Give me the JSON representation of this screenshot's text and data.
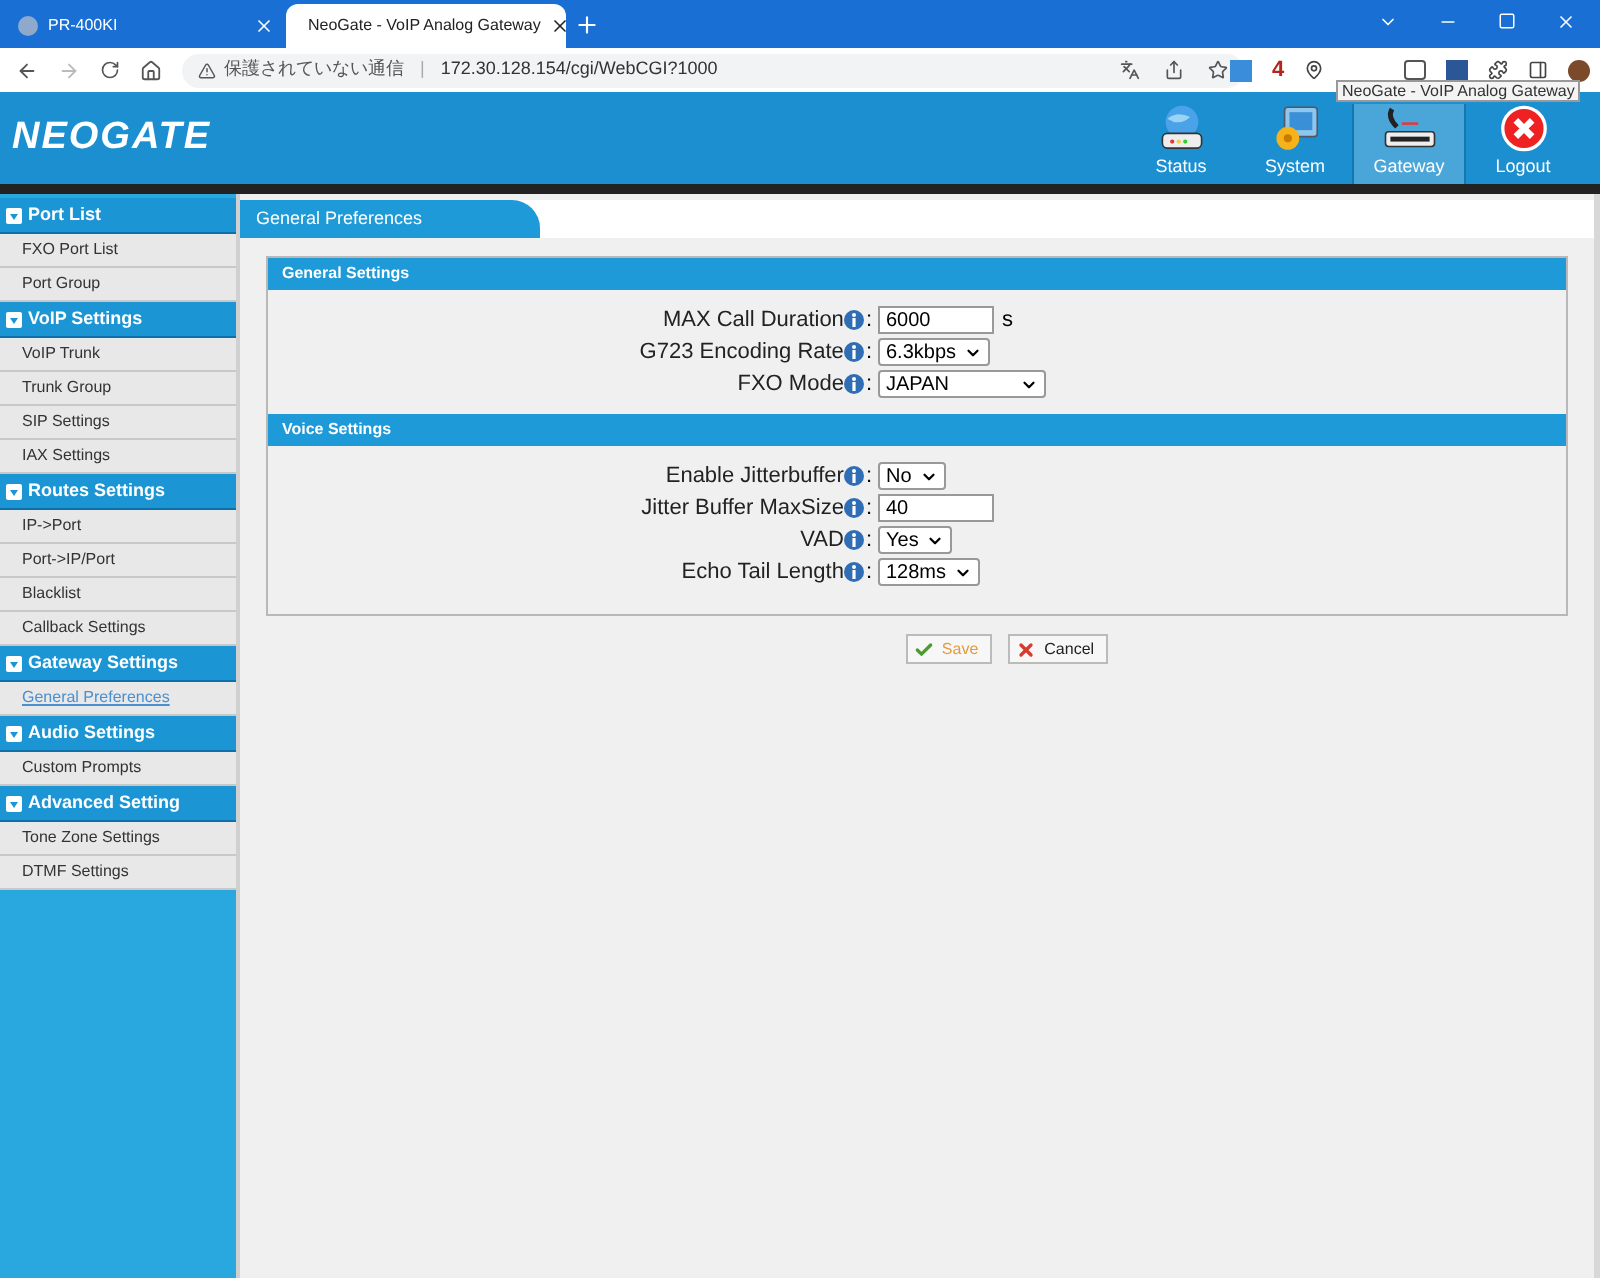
{
  "browser": {
    "tabs": [
      {
        "title": "PR-400KI",
        "selected": false
      },
      {
        "title": "NeoGate - VoIP Analog Gateway",
        "selected": true
      }
    ],
    "security_label": "保護されていない通信",
    "separator": "|",
    "address": "172.30.128.154/cgi/WebCGI?1000",
    "extension_badge": "4"
  },
  "header": {
    "logo": "NEOGATE",
    "tooltip": "NeoGate - VoIP Analog Gateway",
    "nav": [
      {
        "label": "Status",
        "kind": "status",
        "selected": false
      },
      {
        "label": "System",
        "kind": "system",
        "selected": false
      },
      {
        "label": "Gateway",
        "kind": "gateway",
        "selected": true
      },
      {
        "label": "Logout",
        "kind": "logout",
        "selected": false
      }
    ]
  },
  "sidebar": [
    {
      "title": "Port List",
      "items": [
        {
          "label": "FXO Port List",
          "selected": false
        },
        {
          "label": "Port Group",
          "selected": false
        }
      ]
    },
    {
      "title": "VoIP Settings",
      "items": [
        {
          "label": "VoIP Trunk",
          "selected": false
        },
        {
          "label": "Trunk Group",
          "selected": false
        },
        {
          "label": "SIP Settings",
          "selected": false
        },
        {
          "label": "IAX Settings",
          "selected": false
        }
      ]
    },
    {
      "title": "Routes Settings",
      "items": [
        {
          "label": "IP->Port",
          "selected": false
        },
        {
          "label": "Port->IP/Port",
          "selected": false
        },
        {
          "label": "Blacklist",
          "selected": false
        },
        {
          "label": "Callback Settings",
          "selected": false
        }
      ]
    },
    {
      "title": "Gateway Settings",
      "items": [
        {
          "label": "General Preferences",
          "selected": true
        }
      ]
    },
    {
      "title": "Audio Settings",
      "items": [
        {
          "label": "Custom Prompts",
          "selected": false
        }
      ]
    },
    {
      "title": "Advanced Setting",
      "items": [
        {
          "label": "Tone Zone Settings",
          "selected": false
        },
        {
          "label": "DTMF Settings",
          "selected": false
        }
      ]
    }
  ],
  "page_title": "General Preferences",
  "sections": [
    {
      "title": "General Settings",
      "fields": [
        {
          "label": "MAX Call Duration",
          "colon": ":",
          "kind": "text",
          "value": "6000",
          "unit": "s"
        },
        {
          "label": "G723 Encoding Rate",
          "colon": ":",
          "kind": "select",
          "value": "6.3kbps"
        },
        {
          "label": "FXO Mode",
          "colon": ":",
          "kind": "select",
          "value": "JAPAN",
          "wide": true
        }
      ]
    },
    {
      "title": "Voice Settings",
      "fields": [
        {
          "label": "Enable Jitterbuffer",
          "colon": ":",
          "kind": "select",
          "value": "No"
        },
        {
          "label": "Jitter Buffer MaxSize",
          "colon": ":",
          "kind": "text",
          "value": "40"
        },
        {
          "label": "VAD",
          "colon": ":",
          "kind": "select",
          "value": "Yes"
        },
        {
          "label": "Echo Tail Length",
          "colon": ":",
          "kind": "select",
          "value": "128ms"
        }
      ]
    }
  ],
  "buttons": [
    {
      "label": "Save",
      "kind": "save"
    },
    {
      "label": "Cancel",
      "kind": "cancel"
    }
  ]
}
